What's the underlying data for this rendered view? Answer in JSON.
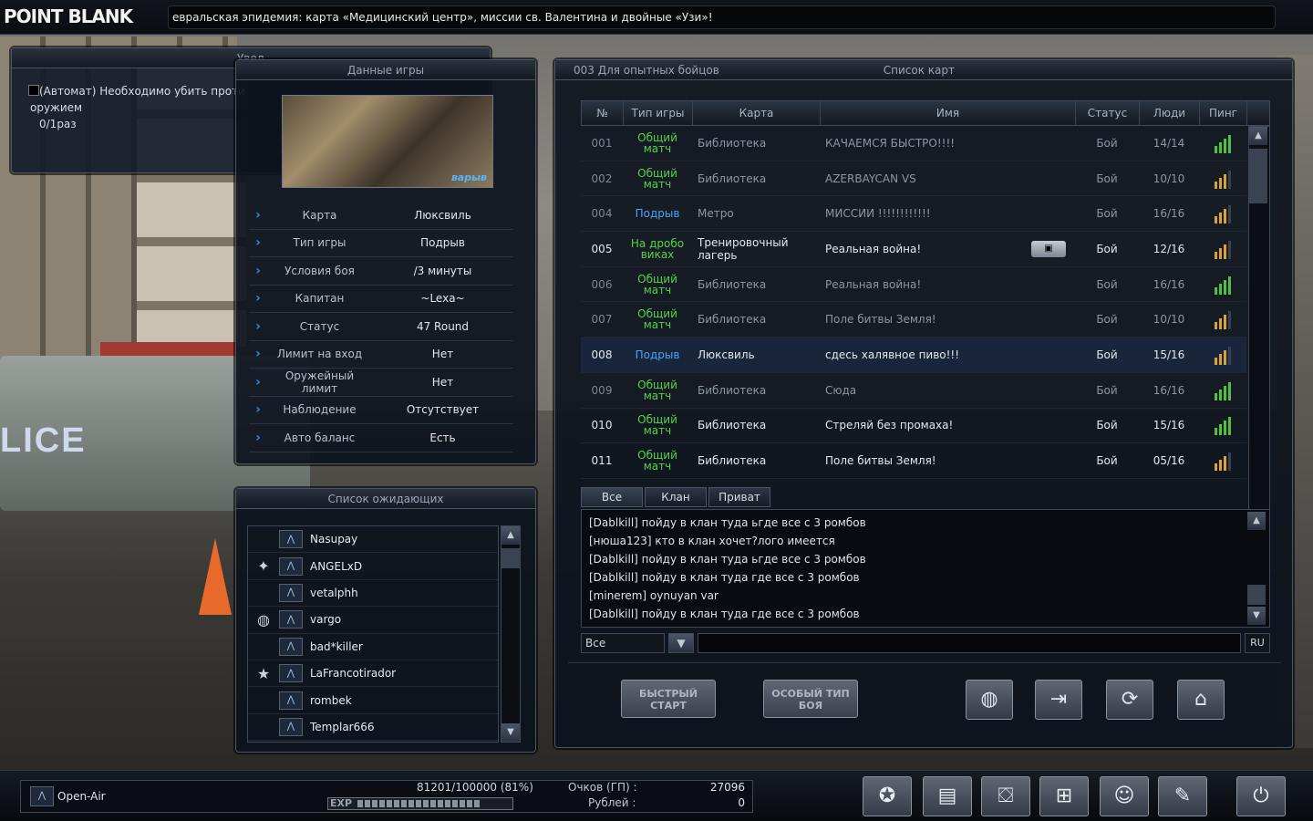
{
  "header": {
    "logo": "POINT BLANK",
    "ticker": "евральская эпидемия: карта «Медицинский центр», миссии св. Валентина и двойные «Узи»!"
  },
  "notify": {
    "title": "Увед",
    "lines": [
      "(Автомат) Необходимо убить проти",
      "оружием",
      "0/1раз"
    ]
  },
  "gamedata": {
    "title": "Данные игры",
    "thumb_tag": "варыв",
    "rows": [
      {
        "k": "Карта",
        "v": "Люксвиль"
      },
      {
        "k": "Тип игры",
        "v": "Подрыв"
      },
      {
        "k": "Условия боя",
        "v": "/3 минуты"
      },
      {
        "k": "Капитан",
        "v": "~Lexa~"
      },
      {
        "k": "Статус",
        "v": "47 Round"
      },
      {
        "k": "Лимит на вход",
        "v": "Нет"
      },
      {
        "k": "Оружейный лимит",
        "v": "Нет"
      },
      {
        "k": "Наблюдение",
        "v": "Отсутствует"
      },
      {
        "k": "Авто баланс",
        "v": "Есть"
      }
    ]
  },
  "waiting": {
    "title": "Список ожидающих",
    "players": [
      {
        "clan": "",
        "nick": "Nasupay"
      },
      {
        "clan": "✦",
        "nick": "ANGELxD"
      },
      {
        "clan": "",
        "nick": "vetalphh"
      },
      {
        "clan": "◍",
        "nick": "vargo"
      },
      {
        "clan": "",
        "nick": "bad*killer"
      },
      {
        "clan": "★",
        "nick": "LaFrancotirador"
      },
      {
        "clan": "",
        "nick": "rombek"
      },
      {
        "clan": "",
        "nick": "Templar666"
      }
    ]
  },
  "roomlist": {
    "room": "003 Для опытных бойцов",
    "title": "Список карт",
    "cols": [
      "№",
      "Тип игры",
      "Карта",
      "Имя",
      "Статус",
      "Люди",
      "Пинг"
    ],
    "rows": [
      {
        "no": "001",
        "type": "Общий матч",
        "tcolor": "green",
        "map": "Библиотека",
        "name": "КАЧАЕМСЯ БЫСТРО!!!!",
        "status": "Бой",
        "people": "14/14",
        "ping": 4,
        "pingcolor": "#4ec23f",
        "bright": false
      },
      {
        "no": "002",
        "type": "Общий матч",
        "tcolor": "green",
        "map": "Библиотека",
        "name": "AZERBAYCAN VS",
        "status": "Бой",
        "people": "10/10",
        "ping": 3,
        "pingcolor": "#d8a23a",
        "bright": false
      },
      {
        "no": "004",
        "type": "Подрыв",
        "tcolor": "blue",
        "map": "Метро",
        "name": "МИССИИ  !!!!!!!!!!!!",
        "status": "Бой",
        "people": "16/16",
        "ping": 3,
        "pingcolor": "#d8a23a",
        "bright": false
      },
      {
        "no": "005",
        "type": "На дробо виках",
        "tcolor": "green",
        "map": "Тренировочный лагерь",
        "name": "Реальная война!",
        "status": "Бой",
        "people": "12/16",
        "ping": 3,
        "pingcolor": "#d8a23a",
        "bright": true,
        "lock": true
      },
      {
        "no": "006",
        "type": "Общий матч",
        "tcolor": "green",
        "map": "Библиотека",
        "name": "Реальная война!",
        "status": "Бой",
        "people": "16/16",
        "ping": 4,
        "pingcolor": "#4ec23f",
        "bright": false
      },
      {
        "no": "007",
        "type": "Общий матч",
        "tcolor": "green",
        "map": "Библиотека",
        "name": "Поле битвы Земля!",
        "status": "Бой",
        "people": "10/10",
        "ping": 3,
        "pingcolor": "#d8a23a",
        "bright": false
      },
      {
        "no": "008",
        "type": "Подрыв",
        "tcolor": "blue",
        "map": "Люксвиль",
        "name": "сдесь халявное пиво!!!",
        "status": "Бой",
        "people": "15/16",
        "ping": 3,
        "pingcolor": "#d8a23a",
        "bright": true,
        "hl": true
      },
      {
        "no": "009",
        "type": "Общий матч",
        "tcolor": "green",
        "map": "Библиотека",
        "name": "Сюда",
        "status": "Бой",
        "people": "16/16",
        "ping": 4,
        "pingcolor": "#4ec23f",
        "bright": false
      },
      {
        "no": "010",
        "type": "Общий матч",
        "tcolor": "green",
        "map": "Библиотека",
        "name": "Стреляй без промаха!",
        "status": "Бой",
        "people": "15/16",
        "ping": 4,
        "pingcolor": "#4ec23f",
        "bright": true
      },
      {
        "no": "011",
        "type": "Общий матч",
        "tcolor": "green",
        "map": "Библиотека",
        "name": "Поле битвы Земля!",
        "status": "Бой",
        "people": "05/16",
        "ping": 3,
        "pingcolor": "#d8a23a",
        "bright": true
      }
    ]
  },
  "chat": {
    "tabs": [
      "Все",
      "Клан",
      "Приват"
    ],
    "lines": [
      "[Dablkill] пойду в клан туда ьгде все с 3 ромбов",
      "[нюша123] кто в клан хочет?лого имеется",
      "[Dablkill] пойду в клан туда ьгде все с 3 ромбов",
      "[Dablkill] пойду в клан туда где все с 3 ромбов",
      "[minerem] oynuyan var",
      "[Dablkill] пойду в клан туда где все с 3 ромбов"
    ],
    "channel": "Все",
    "lang": "RU",
    "input_value": ""
  },
  "actions": {
    "quick_start": "Быстрый старт",
    "special": "Особый тип боя"
  },
  "status": {
    "username": "Open-Air",
    "exp_text": "81201/100000 (81%)",
    "exp_fraction": 0.81,
    "exp_label": "EXP",
    "points_label": "Очков (ГП) :",
    "points_value": "27096",
    "rubles_label": "Рублей :",
    "rubles_value": "0"
  }
}
